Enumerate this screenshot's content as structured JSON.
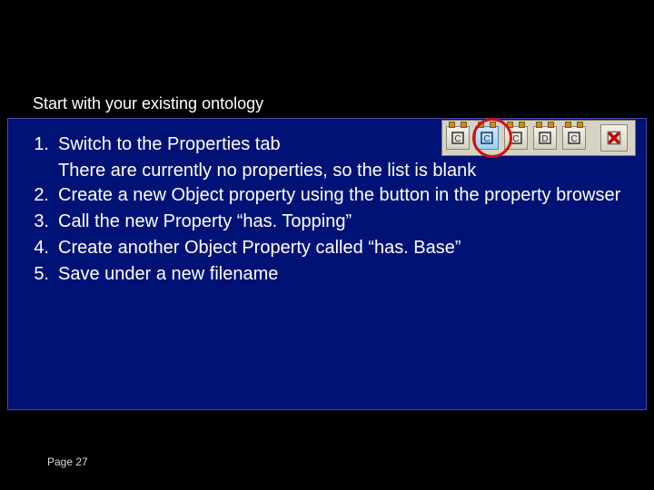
{
  "subtitle": "Start with your existing ontology",
  "steps": [
    {
      "n": "1.",
      "text": "Switch to the Properties tab",
      "cont": "There are currently no properties, so the list is blank"
    },
    {
      "n": "2.",
      "text": "Create a new Object property using the button in the property browser"
    },
    {
      "n": "3.",
      "text": "Call the new Property “has. Topping”"
    },
    {
      "n": "4.",
      "text": "Create another Object Property called “has. Base”"
    },
    {
      "n": "5.",
      "text": "Save under a new filename"
    }
  ],
  "page_label": "Page 27",
  "toolbar": {
    "buttons": [
      {
        "name": "create-class-button",
        "glyph": "C"
      },
      {
        "name": "create-object-property-button",
        "glyph": "C",
        "highlight": true
      },
      {
        "name": "create-subproperty-button",
        "glyph": "C"
      },
      {
        "name": "create-datatype-property-button",
        "glyph": "D"
      },
      {
        "name": "create-annotation-property-button",
        "glyph": "C"
      }
    ],
    "delete_name": "delete-button"
  }
}
